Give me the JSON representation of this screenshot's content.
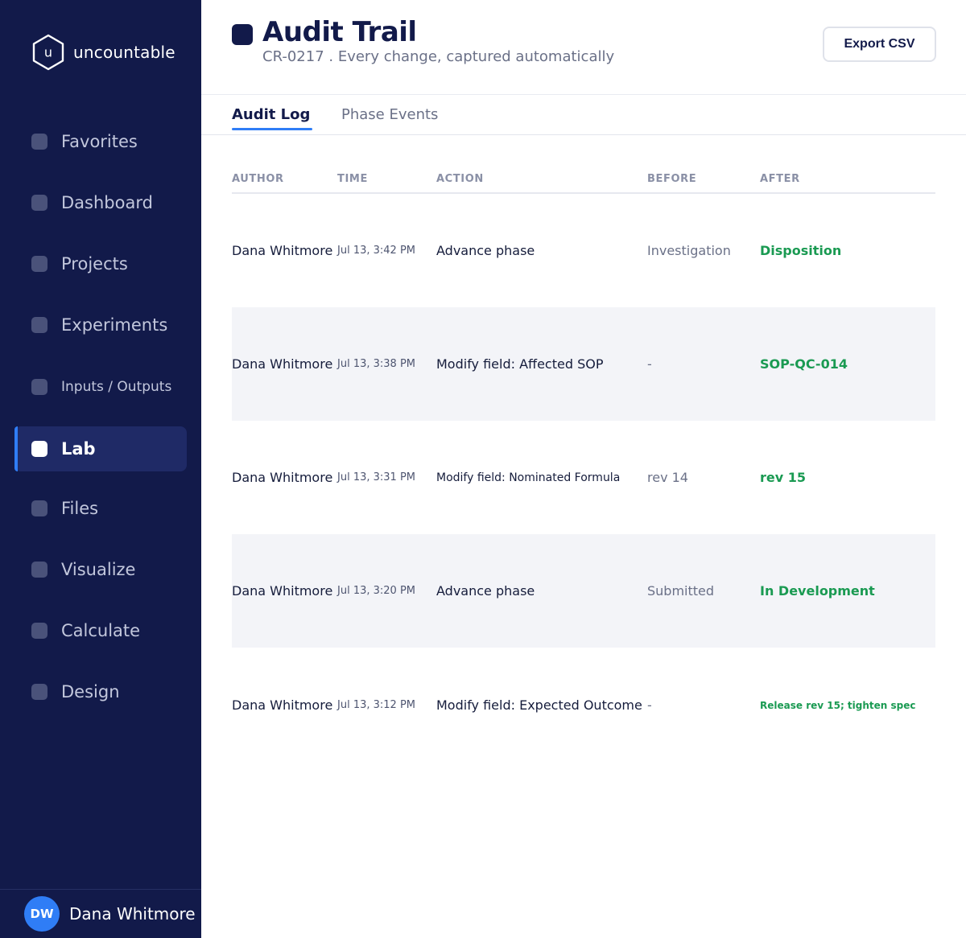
{
  "brand": {
    "name": "uncountable",
    "logo_letter": "u",
    "logo_icon": "hexagon-logo-icon"
  },
  "sidebar": {
    "items": [
      {
        "label": "Favorites",
        "active": false
      },
      {
        "label": "Dashboard",
        "active": false
      },
      {
        "label": "Projects",
        "active": false
      },
      {
        "label": "Experiments",
        "active": false
      },
      {
        "label": "Inputs / Outputs",
        "active": false
      },
      {
        "label": "Lab",
        "active": true
      },
      {
        "label": "Files",
        "active": false
      },
      {
        "label": "Visualize",
        "active": false
      },
      {
        "label": "Calculate",
        "active": false
      },
      {
        "label": "Design",
        "active": false
      }
    ]
  },
  "user": {
    "initials": "DW",
    "name": "Dana Whitmore"
  },
  "header": {
    "title": "Audit Trail",
    "subtitle": "CR-0217 . Every change, captured automatically",
    "export_label": "Export CSV"
  },
  "tabs": [
    {
      "label": "Audit Log",
      "active": true
    },
    {
      "label": "Phase Events",
      "active": false
    }
  ],
  "table": {
    "columns": [
      "AUTHOR",
      "TIME",
      "ACTION",
      "BEFORE",
      "AFTER"
    ],
    "rows": [
      {
        "author": "Dana Whitmore",
        "time": "Jul 13, 3:42 PM",
        "action": "Advance phase",
        "before": "Investigation",
        "after": "Disposition"
      },
      {
        "author": "Dana Whitmore",
        "time": "Jul 13, 3:38 PM",
        "action": "Modify field: Affected SOP",
        "before": "-",
        "after": "SOP-QC-014"
      },
      {
        "author": "Dana Whitmore",
        "time": "Jul 13, 3:31 PM",
        "action": "Modify field: Nominated Formula",
        "before": "rev 14",
        "after": "rev 15"
      },
      {
        "author": "Dana Whitmore",
        "time": "Jul 13, 3:20 PM",
        "action": "Advance phase",
        "before": "Submitted",
        "after": "In Development"
      },
      {
        "author": "Dana Whitmore",
        "time": "Jul 13, 3:12 PM",
        "action": "Modify field: Expected Outcome",
        "before": "-",
        "after": "Release rev 15; tighten spec"
      }
    ]
  },
  "colors": {
    "sidebar_bg": "#121a4a",
    "accent": "#2f7df6",
    "after_value": "#1a9a52",
    "row_shade": "#f3f4f8"
  }
}
